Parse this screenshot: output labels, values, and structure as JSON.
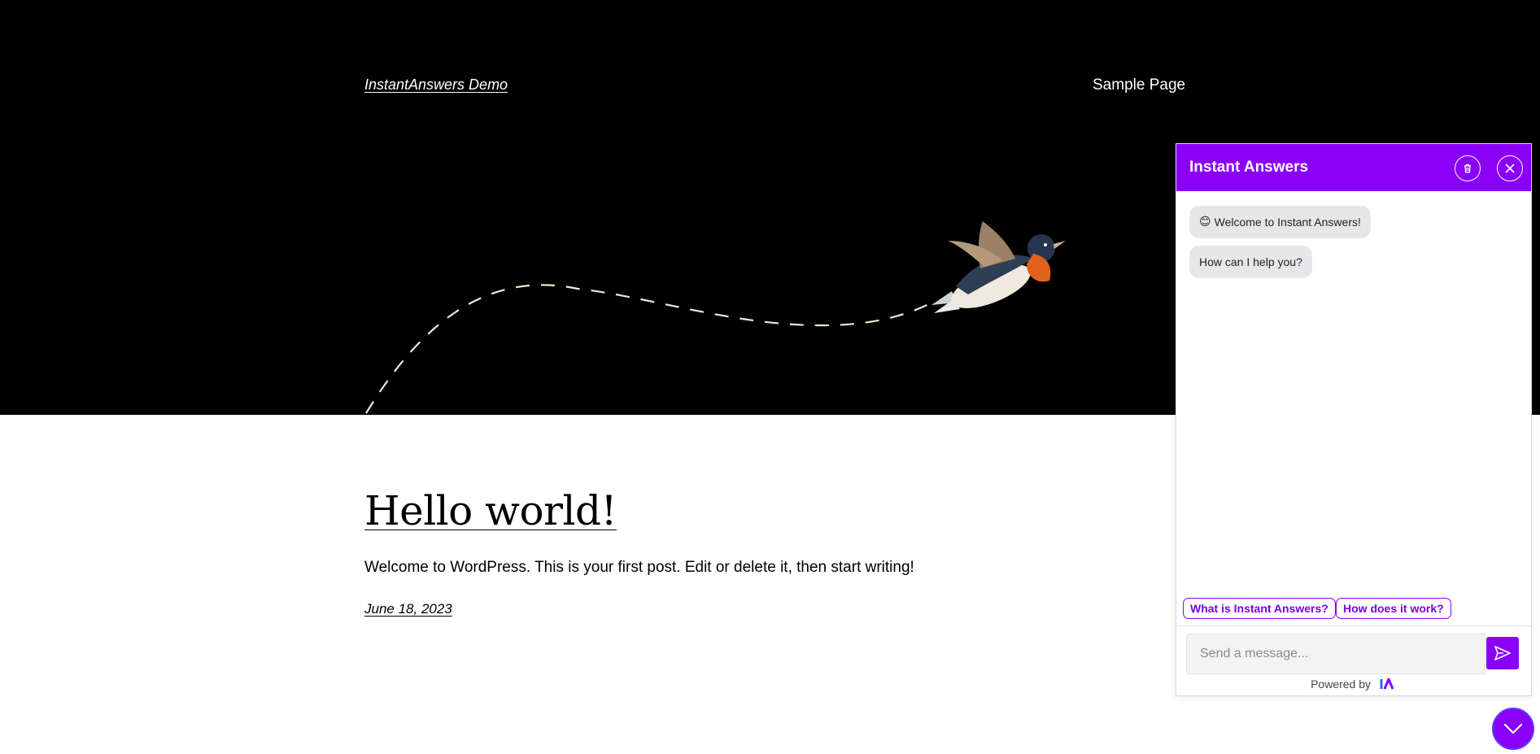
{
  "site": {
    "title": "InstantAnswers Demo",
    "nav": [
      "Sample Page"
    ]
  },
  "post": {
    "title": "Hello world!",
    "excerpt": "Welcome to WordPress. This is your first post. Edit or delete it, then start writing!",
    "date": "June 18, 2023"
  },
  "chat": {
    "title": "Instant Answers",
    "messages": [
      {
        "emoji": "😊",
        "text": "Welcome to Instant Answers!"
      },
      {
        "text": "How can I help you?"
      }
    ],
    "suggestions": [
      "What is Instant Answers?",
      "How does it work?"
    ],
    "input_placeholder": "Send a message...",
    "powered_by": "Powered by",
    "icons": {
      "clear": "trash-icon",
      "close": "close-icon",
      "send": "send-icon",
      "toggle": "chevron-down-icon",
      "brand": "instant-answers-logo"
    }
  },
  "colors": {
    "accent": "#8a00f7",
    "hero_bg": "#000000",
    "bubble_bg": "#e7e7e9"
  }
}
